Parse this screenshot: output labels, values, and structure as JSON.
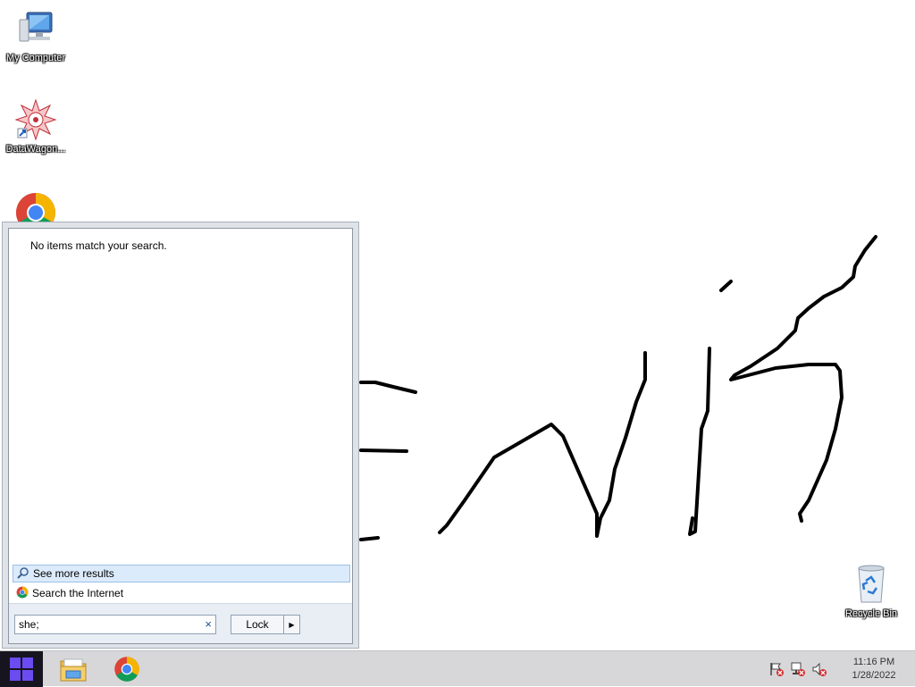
{
  "desktop": {
    "icons": [
      {
        "label": "My Computer",
        "icon": "computer-icon"
      },
      {
        "label": "DataWagon...",
        "icon": "datawagon-icon"
      },
      {
        "label": "",
        "icon": "chrome-icon"
      },
      {
        "label": "Recycle Bin",
        "icon": "recycle-bin-icon"
      }
    ]
  },
  "start_menu": {
    "message": "No items match your search.",
    "see_more": "See more results",
    "search_internet": "Search the Internet",
    "search_value": "she;",
    "clear_symbol": "×",
    "lock_label": "Lock",
    "lock_arrow": "▶"
  },
  "taskbar": {
    "pinned": [
      "file-explorer-icon",
      "chrome-icon"
    ],
    "tray": [
      "action-center-flag-icon",
      "network-icon",
      "volume-muted-icon"
    ],
    "clock_time": "11:16 PM",
    "clock_date": "1/28/2022"
  },
  "colors": {
    "start_button": "#16151f",
    "windows_logo": "#6a4cf0",
    "selection": "#dcebfb"
  }
}
